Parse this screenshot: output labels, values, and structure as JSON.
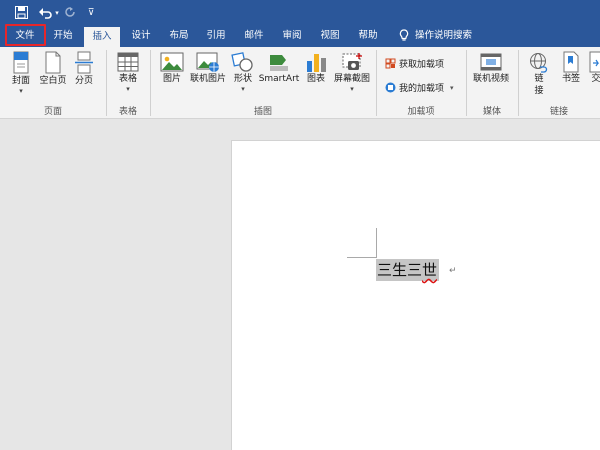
{
  "quick_access": {
    "save_icon": "save-icon",
    "undo_icon": "undo-icon",
    "redo_icon": "redo-icon",
    "customize_label": "⊽"
  },
  "tabs": [
    {
      "label": "文件"
    },
    {
      "label": "开始"
    },
    {
      "label": "插入",
      "active": true
    },
    {
      "label": "设计"
    },
    {
      "label": "布局"
    },
    {
      "label": "引用"
    },
    {
      "label": "邮件"
    },
    {
      "label": "审阅"
    },
    {
      "label": "视图"
    },
    {
      "label": "帮助"
    }
  ],
  "tell_me": {
    "label": "操作说明搜索",
    "icon": "lightbulb-icon"
  },
  "ribbon": {
    "pages_group": {
      "label": "页面",
      "cover": "封面",
      "blank_page": "空白页",
      "page_break": "分页"
    },
    "table_group": {
      "label": "表格",
      "table": "表格"
    },
    "illustrations_group": {
      "label": "插图",
      "pictures": "图片",
      "online_pictures": "联机图片",
      "shapes": "形状",
      "smartart": "SmartArt",
      "chart": "图表",
      "screenshot": "屏幕截图"
    },
    "addins_group": {
      "label": "加载项",
      "get_addins": "获取加载项",
      "my_addins": "我的加载项"
    },
    "media_group": {
      "label": "媒体",
      "online_video": "联机视频"
    },
    "links_group": {
      "label": "链接",
      "link": "链接",
      "bookmark": "书签",
      "cross_ref": "交"
    }
  },
  "document": {
    "text_plain": "三生三",
    "text_flagged": "世",
    "paragraph_mark": "↵"
  },
  "colors": {
    "accent": "#2b579a",
    "highlight_box": "#e8262a"
  }
}
